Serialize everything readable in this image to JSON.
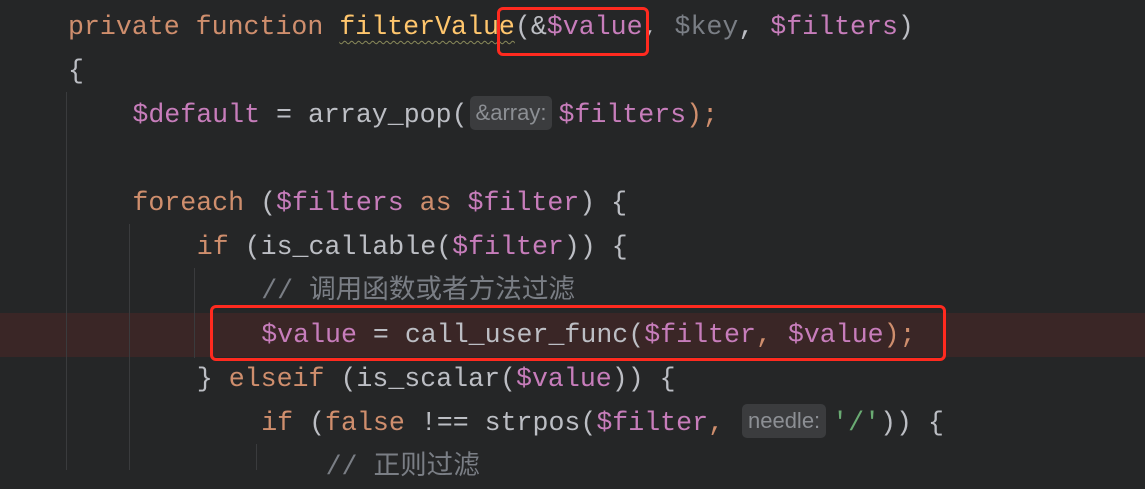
{
  "editor": {
    "language": "PHP",
    "highlighted_line": 7,
    "colors": {
      "keyword": "#cf8e6d",
      "function": "#ffc66d",
      "variable": "#c77dbb",
      "text": "#bcbec4",
      "comment": "#7a7e85",
      "string": "#6aab73",
      "annotation_box": "#ff2a1f"
    },
    "lines": [
      {
        "indent": 0,
        "tokens": [
          {
            "t": "private function ",
            "c": "kw"
          },
          {
            "t": "filterValue",
            "c": "fn"
          },
          {
            "t": "(&",
            "c": "txt"
          },
          {
            "t": "$value",
            "c": "var"
          },
          {
            "t": ", ",
            "c": "txt"
          },
          {
            "t": "$key",
            "c": "dim"
          },
          {
            "t": ", ",
            "c": "txt"
          },
          {
            "t": "$filters",
            "c": "var"
          },
          {
            "t": ")",
            "c": "txt"
          }
        ]
      },
      {
        "indent": 0,
        "tokens": [
          {
            "t": "{",
            "c": "txt"
          }
        ]
      },
      {
        "indent": 4,
        "tokens": [
          {
            "t": "$default",
            "c": "var"
          },
          {
            "t": " = array_pop(",
            "c": "txt"
          },
          {
            "t": "&array:",
            "c": "hint"
          },
          {
            "t": "$filters",
            "c": "var"
          },
          {
            "t": ");",
            "c": "kw"
          }
        ]
      },
      {
        "indent": 0,
        "tokens": []
      },
      {
        "indent": 4,
        "tokens": [
          {
            "t": "foreach",
            "c": "kw"
          },
          {
            "t": " (",
            "c": "txt"
          },
          {
            "t": "$filters",
            "c": "var"
          },
          {
            "t": " as ",
            "c": "kw"
          },
          {
            "t": "$filter",
            "c": "var"
          },
          {
            "t": ") {",
            "c": "txt"
          }
        ]
      },
      {
        "indent": 8,
        "tokens": [
          {
            "t": "if",
            "c": "kw"
          },
          {
            "t": " (is_callable(",
            "c": "txt"
          },
          {
            "t": "$filter",
            "c": "var"
          },
          {
            "t": ")) {",
            "c": "txt"
          }
        ]
      },
      {
        "indent": 12,
        "tokens": [
          {
            "t": "// 调用函数或者方法过滤",
            "c": "cm"
          }
        ]
      },
      {
        "indent": 12,
        "tokens": [
          {
            "t": "$value",
            "c": "var"
          },
          {
            "t": " = call_user_func(",
            "c": "txt"
          },
          {
            "t": "$filter",
            "c": "var"
          },
          {
            "t": ", ",
            "c": "kw"
          },
          {
            "t": "$value",
            "c": "var"
          },
          {
            "t": ");",
            "c": "kw"
          }
        ]
      },
      {
        "indent": 8,
        "tokens": [
          {
            "t": "} ",
            "c": "txt"
          },
          {
            "t": "elseif",
            "c": "kw"
          },
          {
            "t": " (is_scalar(",
            "c": "txt"
          },
          {
            "t": "$value",
            "c": "var"
          },
          {
            "t": ")) {",
            "c": "txt"
          }
        ]
      },
      {
        "indent": 12,
        "tokens": [
          {
            "t": "if",
            "c": "kw"
          },
          {
            "t": " (",
            "c": "txt"
          },
          {
            "t": "false",
            "c": "kw"
          },
          {
            "t": " !== strpos(",
            "c": "txt"
          },
          {
            "t": "$filter",
            "c": "var"
          },
          {
            "t": ", ",
            "c": "kw"
          },
          {
            "t": "needle:",
            "c": "hint"
          },
          {
            "t": "'/'",
            "c": "str"
          },
          {
            "t": ")) {",
            "c": "txt"
          }
        ]
      },
      {
        "indent": 16,
        "tokens": [
          {
            "t": "// 正则过滤",
            "c": "cm"
          }
        ]
      }
    ]
  }
}
